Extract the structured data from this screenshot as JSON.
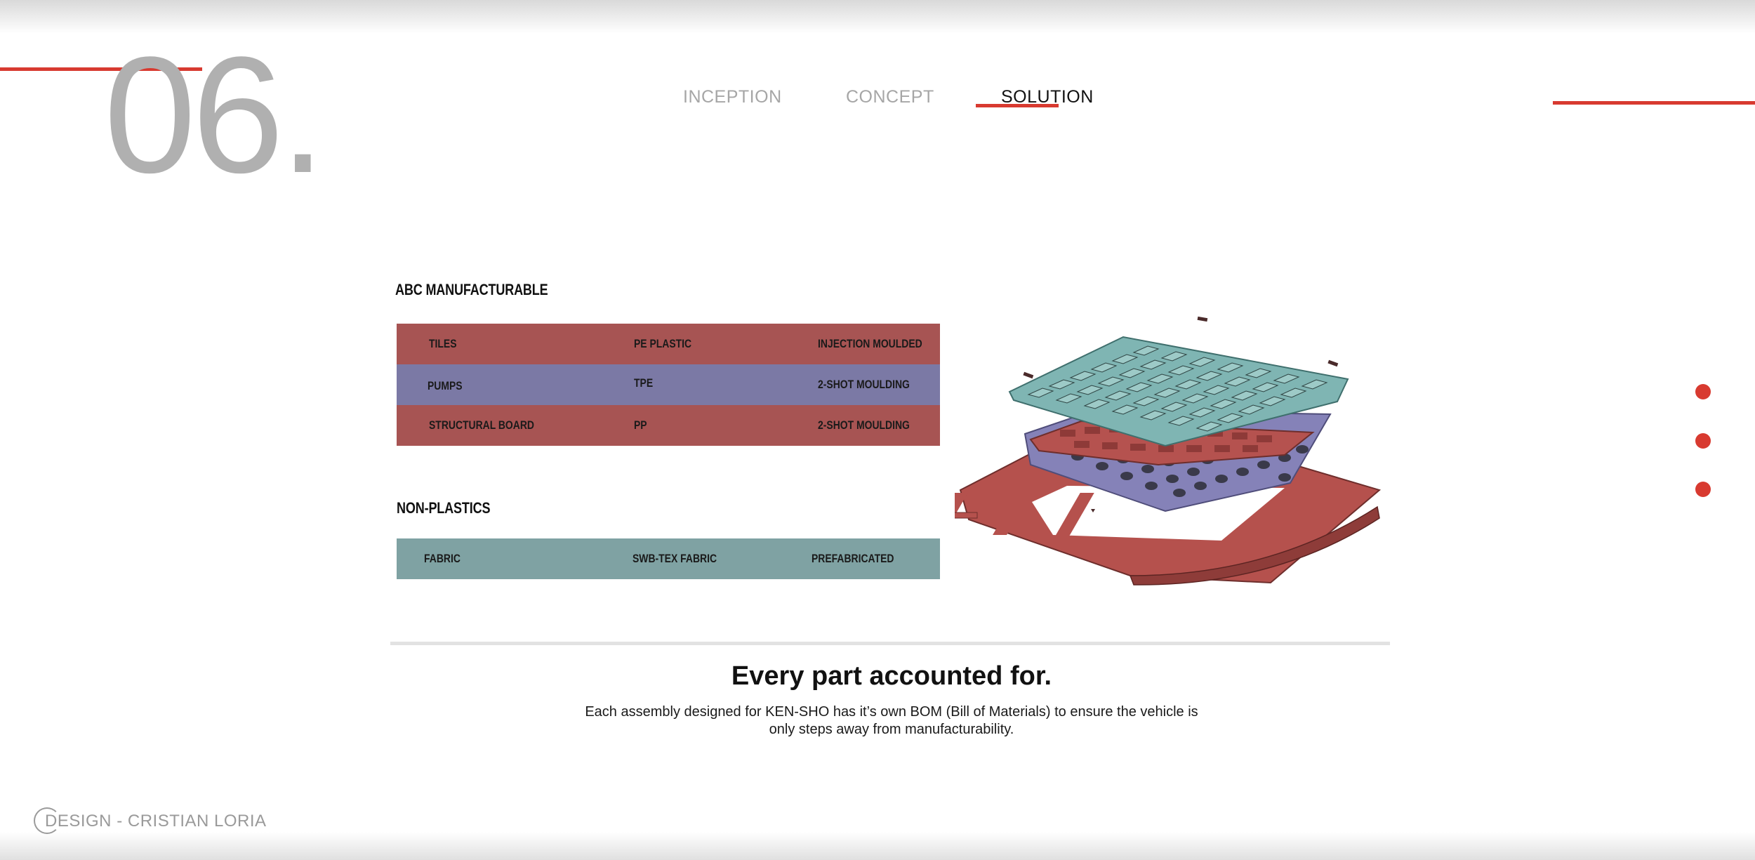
{
  "section_number": "06.",
  "nav": {
    "items": [
      {
        "label": "INCEPTION",
        "active": false
      },
      {
        "label": "CONCEPT",
        "active": false
      },
      {
        "label": "SOLUTION",
        "active": true
      }
    ]
  },
  "side_nav_dots": 3,
  "abc": {
    "title": "ABC MANUFACTURABLE",
    "rows": [
      {
        "part": "TILES",
        "material": "PE PLASTIC",
        "process": "INJECTION MOULDED",
        "color": "#a75453"
      },
      {
        "part": "PUMPS",
        "material": "TPE",
        "process": "2-SHOT MOULDING",
        "color": "#7b79a5"
      },
      {
        "part": "STRUCTURAL BOARD",
        "material": "PP",
        "process": "2-SHOT MOULDING",
        "color": "#a75453"
      }
    ]
  },
  "non_plastics": {
    "title": "NON-PLASTICS",
    "rows": [
      {
        "part": "FABRIC",
        "material": "SWB-TEX FABRIC",
        "process": "PREFABRICATED",
        "color": "#7fa2a3"
      }
    ]
  },
  "headline": "Every part accounted for.",
  "description_line1": "Each assembly designed for KEN-SHO has it’s own BOM (Bill of Materials) to ensure the vehicle is",
  "description_line2": "only steps away from manufacturability.",
  "footer": {
    "logo_text": "DESIGN",
    "separator": "-",
    "author": "CRISTIAN LORIA"
  },
  "colors": {
    "accent": "#d83a30",
    "tile_layer": "#7fb5b3",
    "red_layer": "#b5524f",
    "pump_layer": "#8582b8",
    "frame": "#b5514d"
  }
}
